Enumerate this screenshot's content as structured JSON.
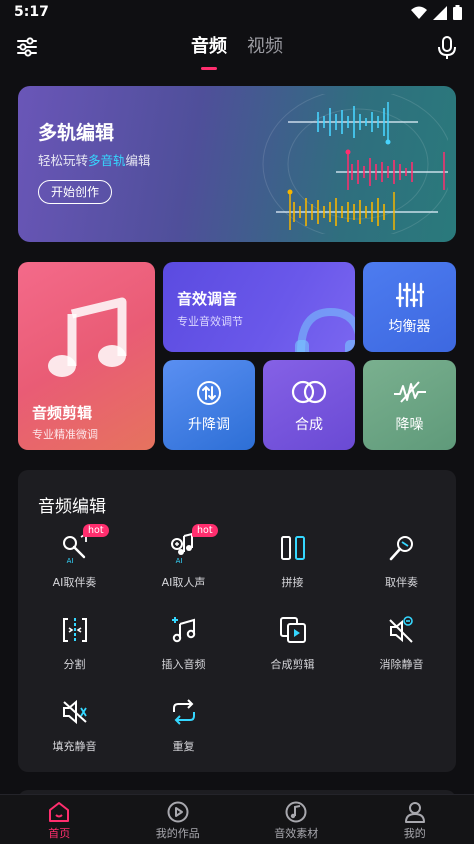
{
  "status": {
    "time": "5:17"
  },
  "header": {
    "tabs": [
      {
        "label": "音频",
        "active": true
      },
      {
        "label": "视频",
        "active": false
      }
    ]
  },
  "banner": {
    "title": "多轨编辑",
    "subtitle_pre": "轻松玩转",
    "subtitle_highlight": "多音轨",
    "subtitle_post": "编辑",
    "button": "开始创作"
  },
  "features": {
    "clip": {
      "title": "音频剪辑",
      "subtitle": "专业精准微调"
    },
    "effects": {
      "title": "音效调音",
      "subtitle": "专业音效调节"
    },
    "equalizer": {
      "title": "均衡器"
    },
    "pitch": {
      "title": "升降调"
    },
    "mix": {
      "title": "合成"
    },
    "denoise": {
      "title": "降噪"
    }
  },
  "audio_edit": {
    "title": "音频编辑",
    "badge": "hot",
    "ai_tag": "AI",
    "tools": [
      {
        "label": "AI取伴奏",
        "icon": "ai-mic-icon",
        "hot": true
      },
      {
        "label": "AI取人声",
        "icon": "ai-voice-icon",
        "hot": true
      },
      {
        "label": "拼接",
        "icon": "splice-icon",
        "hot": false
      },
      {
        "label": "取伴奏",
        "icon": "mic-icon",
        "hot": false
      },
      {
        "label": "分割",
        "icon": "split-icon",
        "hot": false
      },
      {
        "label": "插入音频",
        "icon": "insert-audio-icon",
        "hot": false
      },
      {
        "label": "合成剪辑",
        "icon": "merge-clip-icon",
        "hot": false
      },
      {
        "label": "消除静音",
        "icon": "remove-silence-icon",
        "hot": false
      },
      {
        "label": "填充静音",
        "icon": "fill-silence-icon",
        "hot": false
      },
      {
        "label": "重复",
        "icon": "repeat-icon",
        "hot": false
      }
    ]
  },
  "bottom_nav": [
    {
      "label": "首页",
      "icon": "home-icon",
      "active": true
    },
    {
      "label": "我的作品",
      "icon": "play-circle-icon",
      "active": false
    },
    {
      "label": "音效素材",
      "icon": "music-disc-icon",
      "active": false
    },
    {
      "label": "我的",
      "icon": "user-icon",
      "active": false
    }
  ],
  "colors": {
    "accent": "#ff2e6e",
    "highlight": "#35d7ff",
    "background": "#0f0f12",
    "panel": "#1d1d21"
  }
}
